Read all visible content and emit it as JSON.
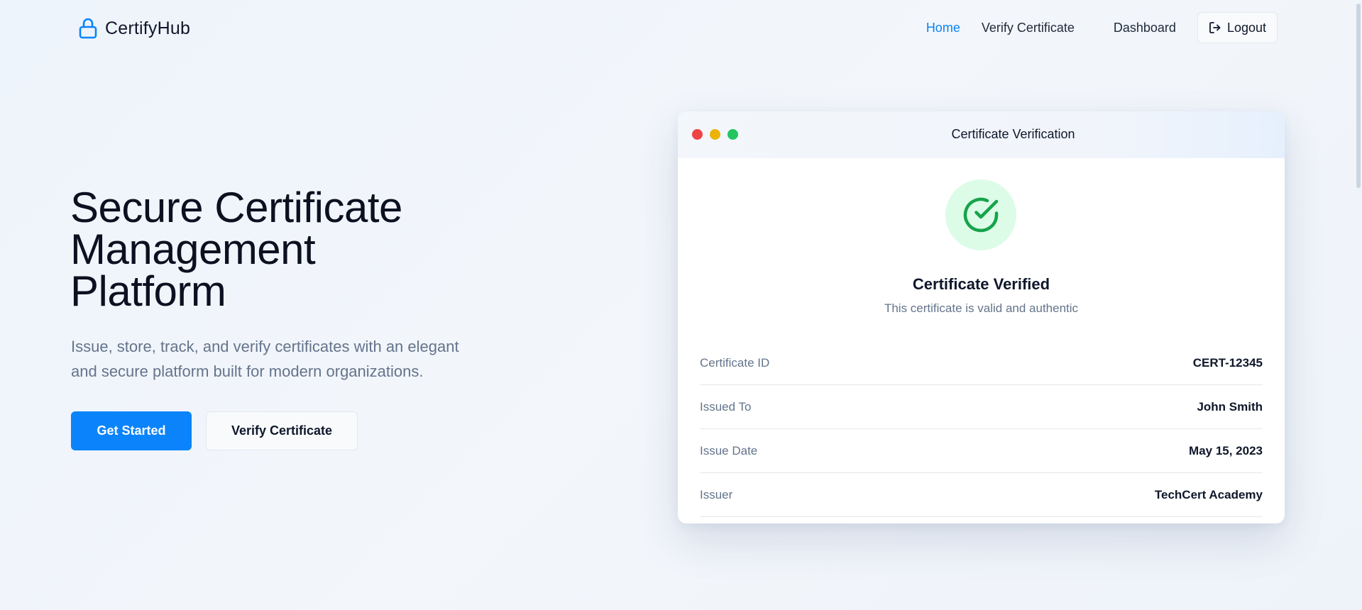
{
  "header": {
    "brand_name": "CertifyHub",
    "brand_icon": "lock-icon",
    "nav": {
      "home": "Home",
      "verify": "Verify Certificate",
      "dashboard": "Dashboard",
      "logout": "Logout"
    },
    "active_nav": "home"
  },
  "hero": {
    "title_line1": "Secure Certificate",
    "title_line2": "Management",
    "title_line3": "Platform",
    "subtitle_line1": "Issue, store, track, and verify certificates with an elegant",
    "subtitle_line2": "and secure platform built for modern organizations.",
    "primary_cta": "Get Started",
    "secondary_cta": "Verify Certificate"
  },
  "card": {
    "window_title": "Certificate Verification",
    "status_icon": "check-circle-icon",
    "status_title": "Certificate Verified",
    "status_subtitle": "This certificate is valid and authentic",
    "details": [
      {
        "label": "Certificate ID",
        "value": "CERT-12345"
      },
      {
        "label": "Issued To",
        "value": "John Smith"
      },
      {
        "label": "Issue Date",
        "value": "May 15, 2023"
      },
      {
        "label": "Issuer",
        "value": "TechCert Academy"
      }
    ]
  },
  "colors": {
    "accent": "#0b84fb",
    "success": "#16a34a",
    "success_bg": "#dcfce7",
    "window_dot_red": "#ef4444",
    "window_dot_yellow": "#eab308",
    "window_dot_green": "#22c55e"
  }
}
